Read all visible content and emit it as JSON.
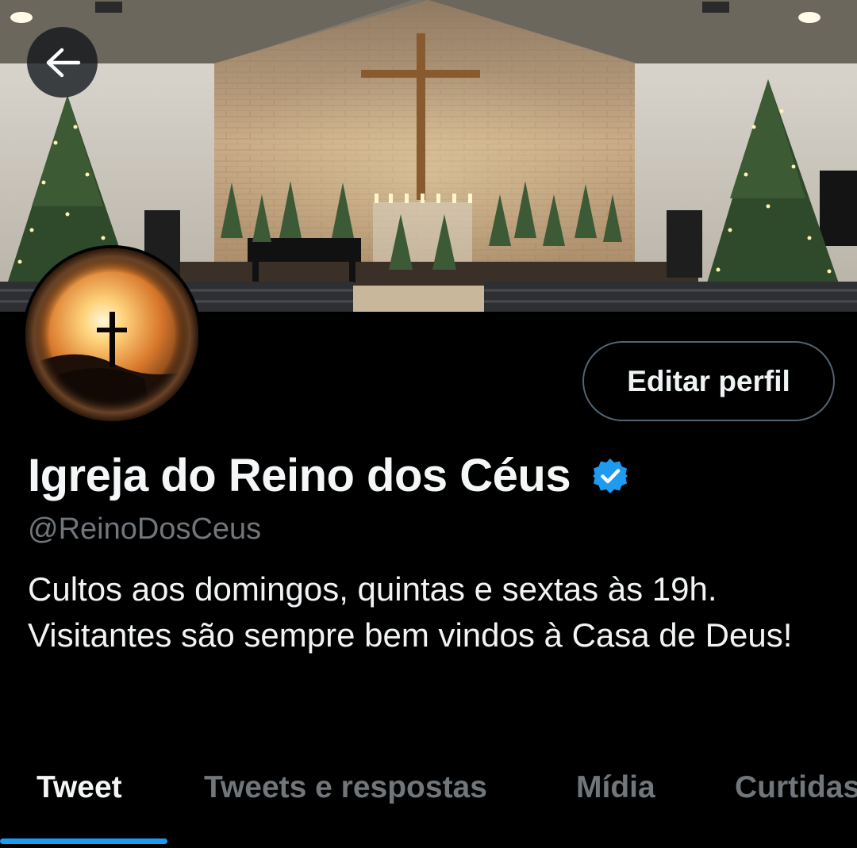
{
  "header": {
    "back_icon": "arrow-left-icon"
  },
  "profile": {
    "display_name": "Igreja do Reino dos Céus",
    "handle": "@ReinoDosCeus",
    "verified_icon": "verified-badge-icon",
    "verified_color": "#1d9bf0",
    "edit_label": "Editar perfil",
    "bio": "Cultos aos domingos, quintas e sextas às 19h. Visitantes são sempre bem vindos à Casa de Deus!"
  },
  "tabs": [
    {
      "label": "Tweet",
      "active": true
    },
    {
      "label": "Tweets e respostas",
      "active": false
    },
    {
      "label": "Mídia",
      "active": false
    },
    {
      "label": "Curtidas",
      "active": false
    }
  ],
  "colors": {
    "accent": "#1d9bf0",
    "background": "#000000",
    "secondary_text": "#71767b"
  }
}
